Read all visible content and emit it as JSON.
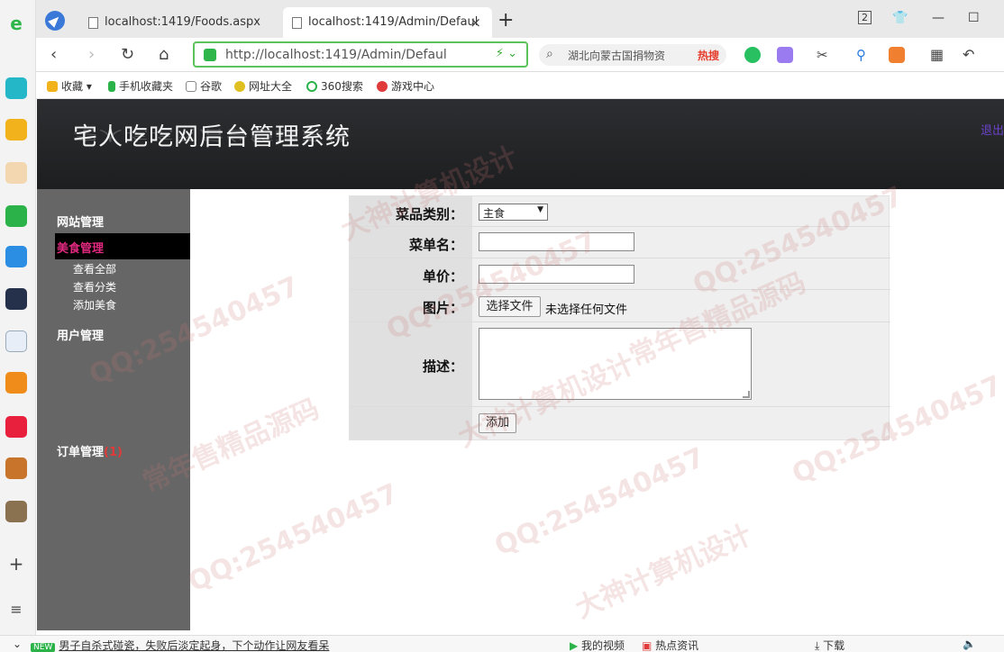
{
  "browser": {
    "tabs": [
      {
        "label": "localhost:1419/Foods.aspx"
      },
      {
        "label": "localhost:1419/Admin/Defaul"
      }
    ],
    "new_tab_glyph": "+",
    "tab_close_glyph": "×",
    "window_count": "2",
    "url": "http://localhost:1419/Admin/Defaul",
    "url_host_bold": "localhost",
    "search_placeholder": "湖北向蒙古国捐物资",
    "search_hot_label": "热搜",
    "bookmarks": [
      {
        "label": "收藏"
      },
      {
        "label": "手机收藏夹"
      },
      {
        "label": "谷歌"
      },
      {
        "label": "网址大全"
      },
      {
        "label": "360搜索"
      },
      {
        "label": "游戏中心"
      }
    ],
    "icons": [
      "compass-icon",
      "back-arrow-icon",
      "forward-arrow-icon",
      "refresh-icon",
      "home-icon",
      "shield-icon",
      "lightning-icon",
      "magnifier-icon",
      "translate-icon",
      "scissors-icon",
      "game-controller-icon",
      "grid-icon",
      "undo-icon"
    ]
  },
  "header": {
    "site_title": "宅人吃吃网后台管理系统",
    "top_link": "退出"
  },
  "sidebar": {
    "site_manage": "网站管理",
    "food_manage": "美食管理",
    "sub_items": [
      {
        "label": "查看全部"
      },
      {
        "label": "查看分类"
      },
      {
        "label": "添加美食"
      }
    ],
    "user_manage": "用户管理",
    "order_manage": "订单管理",
    "order_count": "(1)"
  },
  "form": {
    "category_label": "菜品类别：",
    "category_value": "主食",
    "dish_label": "菜单名：",
    "price_label": "单价：",
    "image_label": "图片：",
    "file_button": "选择文件",
    "file_status": "未选择任何文件",
    "desc_label": "描述：",
    "submit_label": "添加"
  },
  "statusbar": {
    "new_badge": "NEW",
    "headline": "男子自杀式碰瓷，失败后淡定起身，下个动作让网友看呆",
    "my_video": "我的视频",
    "hot_news": "热点资讯",
    "download": "下载"
  },
  "watermarks": [
    "大神计算机设计",
    "QQ:25454045​7",
    "常年售精品源码"
  ],
  "colors": {
    "header_bg": "#1f2022",
    "sidebar_bg": "#666666",
    "active_menu_text": "#e0297e",
    "url_border": "#5cc35c"
  }
}
